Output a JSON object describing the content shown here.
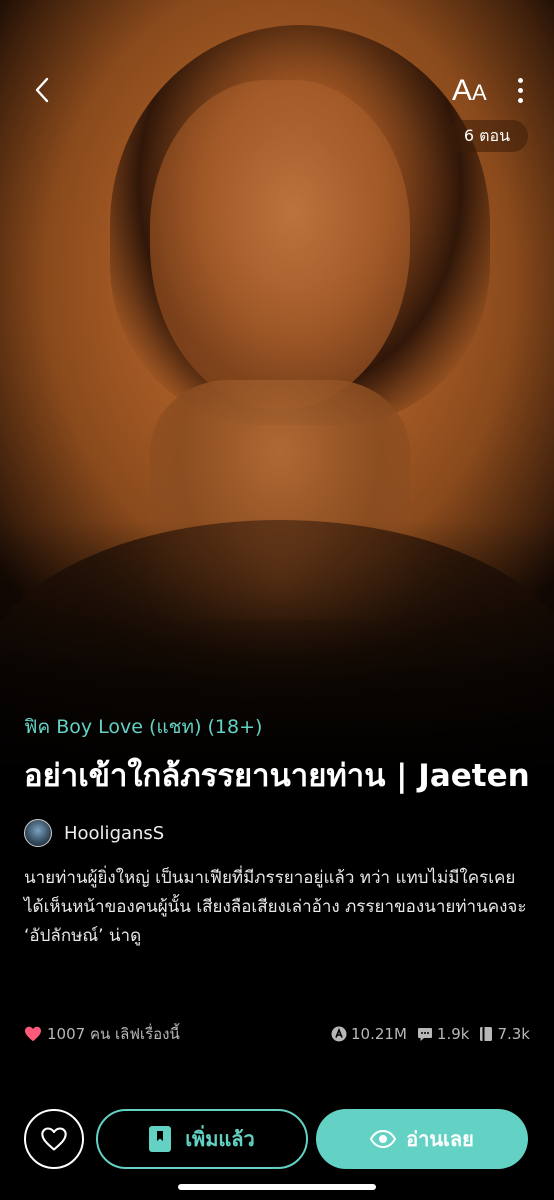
{
  "header": {
    "font_size_label_big": "A",
    "font_size_label_small": "A",
    "episodes_badge": "6 ตอน"
  },
  "story": {
    "category": "ฟิค Boy Love (แชท) (18+)",
    "title": "อย่าเข้าใกล้ภรรยานายท่าน | Jaeten",
    "author": "HooligansS",
    "synopsis": "นายท่านผู้ยิ่งใหญ่ เป็นมาเฟียที่มีภรรยาอยู่แล้ว ทว่า แทบไม่มีใครเคยได้เห็นหน้าของคนผู้นั้น เสียงลือเสียงเล่าอ้าง ภรรยาของนายท่านคงจะ ‘อัปลักษณ์’ น่าดู"
  },
  "stats": {
    "likes_text": "1007 คน เลิฟเรื่องนี้",
    "views": "10.21M",
    "comments": "1.9k",
    "bookmarks": "7.3k"
  },
  "actions": {
    "added_label": "เพิ่มแล้ว",
    "read_label": "อ่านเลย"
  },
  "colors": {
    "accent": "#63d1c3",
    "like": "#ff5a7a",
    "background": "#000000"
  },
  "icons": [
    "back-arrow-icon",
    "more-vertical-icon",
    "heart-icon",
    "bookmark-icon",
    "eye-icon",
    "views-icon",
    "comment-icon",
    "book-icon"
  ]
}
